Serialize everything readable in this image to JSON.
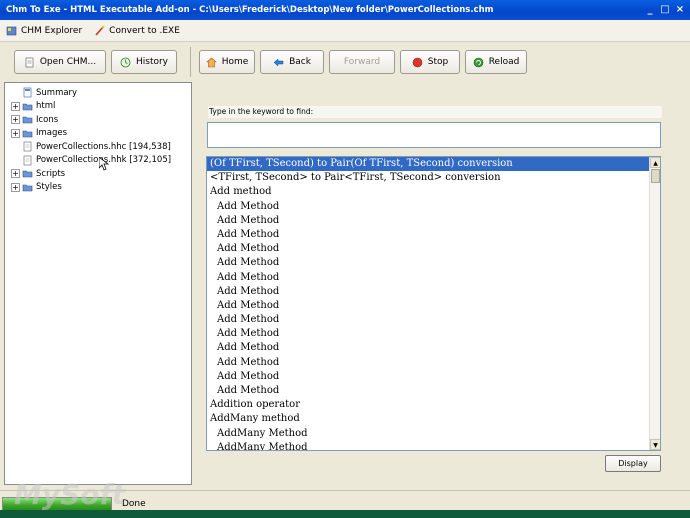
{
  "window": {
    "title": "Chm To Exe - HTML Executable Add-on - C:\\Users\\Frederick\\Desktop\\New folder\\PowerCollections.chm",
    "controls": [
      "_",
      "□",
      "×"
    ]
  },
  "menubar": {
    "chm_explorer": "CHM Explorer",
    "convert_to_exe": "Convert to .EXE"
  },
  "toolbar": {
    "open_chm": "Open CHM...",
    "history": "History",
    "home": "Home",
    "back": "Back",
    "forward": "Forward",
    "stop": "Stop",
    "reload": "Reload"
  },
  "tree": {
    "items": [
      {
        "label": "Summary",
        "icon": "page-icon",
        "expandable": false
      },
      {
        "label": "html",
        "icon": "folder-icon",
        "expandable": true
      },
      {
        "label": "Icons",
        "icon": "folder-icon",
        "expandable": true
      },
      {
        "label": "Images",
        "icon": "folder-icon",
        "expandable": true
      },
      {
        "label": "PowerCollections.hhc [194,538]",
        "icon": "file-icon",
        "expandable": false
      },
      {
        "label": "PowerCollections.hhk [372,105]",
        "icon": "file-icon",
        "expandable": false
      },
      {
        "label": "Scripts",
        "icon": "folder-icon",
        "expandable": true
      },
      {
        "label": "Styles",
        "icon": "folder-icon",
        "expandable": true
      }
    ]
  },
  "search": {
    "label": "Type in the keyword to find:",
    "value": ""
  },
  "index_list": {
    "items": [
      {
        "text": "(Of TFirst, TSecond) to Pair(Of TFirst, TSecond) conversion",
        "indent": 0,
        "selected": true
      },
      {
        "text": "<TFirst, TSecond> to Pair<TFirst, TSecond> conversion",
        "indent": 0,
        "selected": false
      },
      {
        "text": "Add method",
        "indent": 0,
        "selected": false
      },
      {
        "text": "Add Method",
        "indent": 1,
        "selected": false
      },
      {
        "text": "Add Method",
        "indent": 1,
        "selected": false
      },
      {
        "text": "Add Method",
        "indent": 1,
        "selected": false
      },
      {
        "text": "Add Method",
        "indent": 1,
        "selected": false
      },
      {
        "text": "Add Method",
        "indent": 1,
        "selected": false
      },
      {
        "text": "Add Method",
        "indent": 1,
        "selected": false
      },
      {
        "text": "Add Method",
        "indent": 1,
        "selected": false
      },
      {
        "text": "Add Method",
        "indent": 1,
        "selected": false
      },
      {
        "text": "Add Method",
        "indent": 1,
        "selected": false
      },
      {
        "text": "Add Method",
        "indent": 1,
        "selected": false
      },
      {
        "text": "Add Method",
        "indent": 1,
        "selected": false
      },
      {
        "text": "Add Method",
        "indent": 1,
        "selected": false
      },
      {
        "text": "Add Method",
        "indent": 1,
        "selected": false
      },
      {
        "text": "Add Method",
        "indent": 1,
        "selected": false
      },
      {
        "text": "Addition operator",
        "indent": 0,
        "selected": false
      },
      {
        "text": "AddMany method",
        "indent": 0,
        "selected": false
      },
      {
        "text": "AddMany Method",
        "indent": 1,
        "selected": false
      },
      {
        "text": "AddMany Method",
        "indent": 1,
        "selected": false
      }
    ]
  },
  "display_button": "Display",
  "status": {
    "text": "Done",
    "progress_percent": 100
  },
  "watermark": "MySoft",
  "colors": {
    "title_bar": "#0346c9",
    "selection": "#316ac5",
    "progress": "#3aa628"
  }
}
